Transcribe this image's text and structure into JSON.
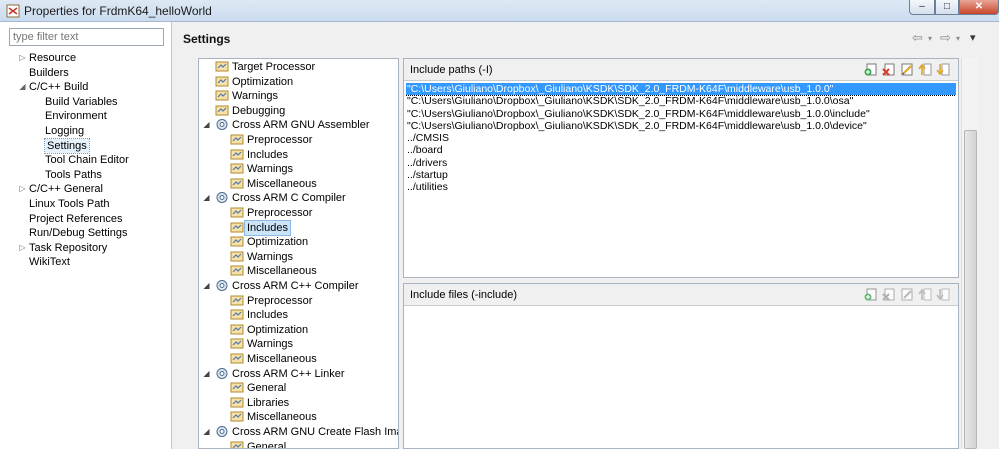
{
  "window": {
    "title": "Properties for FrdmK64_helloWorld",
    "minimize_glyph": "–",
    "maximize_glyph": "□",
    "close_glyph": "✕"
  },
  "filter": {
    "placeholder": "type filter text",
    "value": "type filter text"
  },
  "nav": {
    "items": [
      {
        "label": "Resource",
        "twisty": "▷"
      },
      {
        "label": "Builders",
        "twisty": ""
      },
      {
        "label": "C/C++ Build",
        "twisty": "◢"
      },
      {
        "label": "Build Variables",
        "twisty": ""
      },
      {
        "label": "Environment",
        "twisty": ""
      },
      {
        "label": "Logging",
        "twisty": ""
      },
      {
        "label": "Settings",
        "twisty": ""
      },
      {
        "label": "Tool Chain Editor",
        "twisty": ""
      },
      {
        "label": "Tools Paths",
        "twisty": ""
      },
      {
        "label": "C/C++ General",
        "twisty": "▷"
      },
      {
        "label": "Linux Tools Path",
        "twisty": ""
      },
      {
        "label": "Project References",
        "twisty": ""
      },
      {
        "label": "Run/Debug Settings",
        "twisty": ""
      },
      {
        "label": "Task Repository",
        "twisty": "▷"
      },
      {
        "label": "WikiText",
        "twisty": ""
      }
    ],
    "selected": "Settings"
  },
  "header": {
    "title": "Settings",
    "back_icon": "⇦",
    "forward_icon": "⇨",
    "menu_icon": "▾"
  },
  "tool_tree": {
    "rows": [
      {
        "label": "Target Processor",
        "toggle": ""
      },
      {
        "label": "Optimization",
        "toggle": ""
      },
      {
        "label": "Warnings",
        "toggle": ""
      },
      {
        "label": "Debugging",
        "toggle": ""
      },
      {
        "label": "Cross ARM GNU Assembler",
        "toggle": "◢"
      },
      {
        "label": "Preprocessor",
        "toggle": ""
      },
      {
        "label": "Includes",
        "toggle": ""
      },
      {
        "label": "Warnings",
        "toggle": ""
      },
      {
        "label": "Miscellaneous",
        "toggle": ""
      },
      {
        "label": "Cross ARM C Compiler",
        "toggle": "◢"
      },
      {
        "label": "Preprocessor",
        "toggle": ""
      },
      {
        "label": "Includes",
        "toggle": ""
      },
      {
        "label": "Optimization",
        "toggle": ""
      },
      {
        "label": "Warnings",
        "toggle": ""
      },
      {
        "label": "Miscellaneous",
        "toggle": ""
      },
      {
        "label": "Cross ARM C++ Compiler",
        "toggle": "◢"
      },
      {
        "label": "Preprocessor",
        "toggle": ""
      },
      {
        "label": "Includes",
        "toggle": ""
      },
      {
        "label": "Optimization",
        "toggle": ""
      },
      {
        "label": "Warnings",
        "toggle": ""
      },
      {
        "label": "Miscellaneous",
        "toggle": ""
      },
      {
        "label": "Cross ARM C++ Linker",
        "toggle": "◢"
      },
      {
        "label": "General",
        "toggle": ""
      },
      {
        "label": "Libraries",
        "toggle": ""
      },
      {
        "label": "Miscellaneous",
        "toggle": ""
      },
      {
        "label": "Cross ARM GNU Create Flash Image",
        "toggle": "◢"
      },
      {
        "label": "General",
        "toggle": ""
      }
    ],
    "selected": "Includes"
  },
  "include_paths": {
    "title": "Include paths (-I)",
    "items": [
      "\"C:\\Users\\Giuliano\\Dropbox\\_Giuliano\\KSDK\\SDK_2.0_FRDM-K64F\\middleware\\usb_1.0.0\"",
      "\"C:\\Users\\Giuliano\\Dropbox\\_Giuliano\\KSDK\\SDK_2.0_FRDM-K64F\\middleware\\usb_1.0.0\\osa\"",
      "\"C:\\Users\\Giuliano\\Dropbox\\_Giuliano\\KSDK\\SDK_2.0_FRDM-K64F\\middleware\\usb_1.0.0\\include\"",
      "\"C:\\Users\\Giuliano\\Dropbox\\_Giuliano\\KSDK\\SDK_2.0_FRDM-K64F\\middleware\\usb_1.0.0\\device\"",
      "../CMSIS",
      "../board",
      "../drivers",
      "../startup",
      "../utilities"
    ],
    "selected_index": 0
  },
  "include_files": {
    "title": "Include files (-include)",
    "items": []
  },
  "colors": {
    "selection": "#3399ff",
    "tree_selection": "#cce4f7",
    "delete_red": "#d43a2a",
    "move_gold": "#e0a52a"
  }
}
